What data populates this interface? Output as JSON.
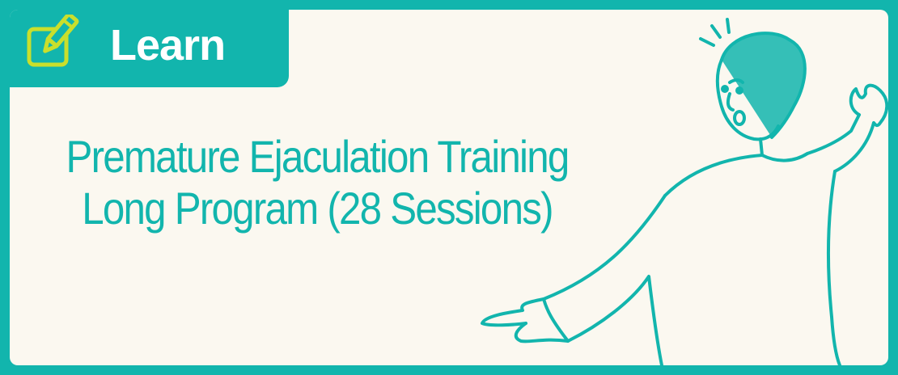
{
  "tab": {
    "label": "Learn",
    "icon": "pencil-square-icon"
  },
  "title": {
    "line1": "Premature Ejaculation Training",
    "line2": "Long Program (28 Sessions)"
  },
  "colors": {
    "accent": "#12b5ad",
    "background": "#fbf8f0",
    "icon": "#c9df2c"
  },
  "illustration": {
    "description_icon": "surprised-person-pointing-icon"
  }
}
